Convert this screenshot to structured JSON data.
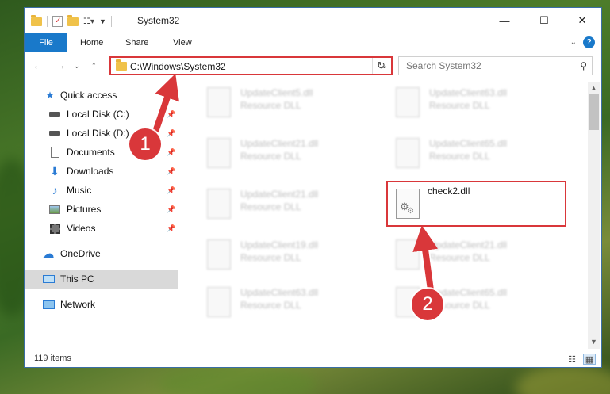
{
  "window": {
    "title": "System32",
    "controls": {
      "minimize": "—",
      "maximize": "☐",
      "close": "✕"
    }
  },
  "ribbon": {
    "tabs": [
      {
        "label": "File",
        "active": true
      },
      {
        "label": "Home"
      },
      {
        "label": "Share"
      },
      {
        "label": "View"
      }
    ]
  },
  "navigation": {
    "address_path": "C:\\Windows\\System32",
    "search_placeholder": "Search System32"
  },
  "sidebar": {
    "items": [
      {
        "label": "Quick access",
        "icon": "star-icon",
        "pinned": false
      },
      {
        "label": "Local Disk (C:)",
        "icon": "drive-icon",
        "pinned": true
      },
      {
        "label": "Local Disk (D:)",
        "icon": "drive-icon",
        "pinned": true
      },
      {
        "label": "Documents",
        "icon": "documents-icon",
        "pinned": true
      },
      {
        "label": "Downloads",
        "icon": "download-icon",
        "pinned": true
      },
      {
        "label": "Music",
        "icon": "music-icon",
        "pinned": true
      },
      {
        "label": "Pictures",
        "icon": "pictures-icon",
        "pinned": true
      },
      {
        "label": "Videos",
        "icon": "videos-icon",
        "pinned": true
      },
      {
        "label": "OneDrive",
        "icon": "cloud-icon",
        "pinned": false
      },
      {
        "label": "This PC",
        "icon": "computer-icon",
        "pinned": false,
        "selected": true
      },
      {
        "label": "Network",
        "icon": "network-icon",
        "pinned": false
      }
    ]
  },
  "files": [
    {
      "name": "UpdateClient5.dll",
      "type": "Resource DLL",
      "blurred": true
    },
    {
      "name": "UpdateClient63.dll",
      "type": "Resource DLL",
      "blurred": true
    },
    {
      "name": "UpdateClient21.dll",
      "type": "Resource DLL",
      "blurred": true
    },
    {
      "name": "UpdateClient65.dll",
      "type": "Resource DLL",
      "blurred": true
    },
    {
      "name": "UpdateClient21.dll",
      "type": "Resource DLL",
      "blurred": true
    },
    {
      "name": "check2.dll",
      "type": "",
      "blurred": false,
      "highlighted": true
    },
    {
      "name": "UpdateClient19.dll",
      "type": "Resource DLL",
      "blurred": true
    },
    {
      "name": "UpdateClient21.dll",
      "type": "Resource DLL",
      "blurred": true
    },
    {
      "name": "UpdateClient63.dll",
      "type": "Resource DLL",
      "blurred": true
    },
    {
      "name": "UpdateClient65.dll",
      "type": "Resource DLL",
      "blurred": true
    }
  ],
  "status": {
    "item_count": "119 items"
  },
  "annotations": {
    "step1": "1",
    "step2": "2",
    "color": "#d9373a"
  },
  "colors": {
    "accent": "#1979ca",
    "highlight": "#d9373a",
    "selected_bg": "#d9d9d9"
  }
}
